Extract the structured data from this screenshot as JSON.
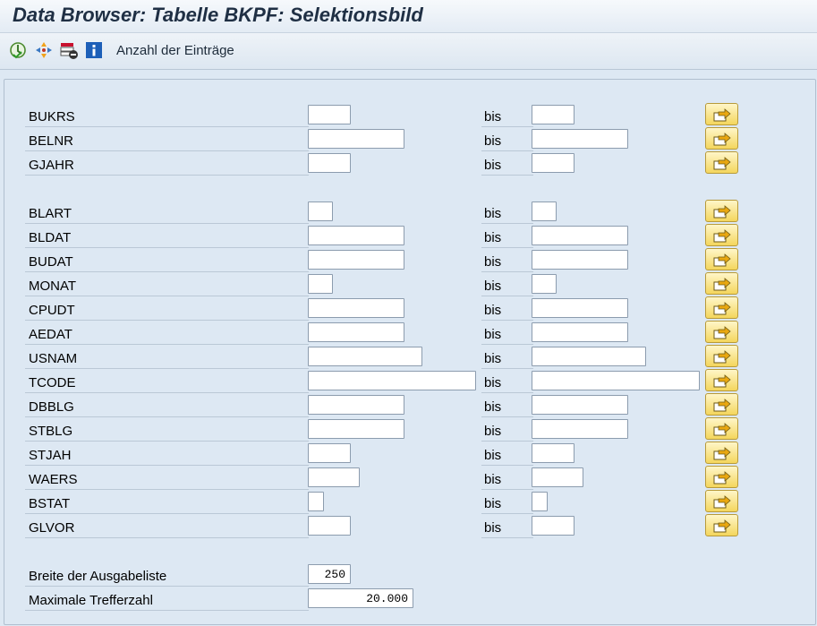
{
  "window": {
    "title": "Data Browser: Tabelle BKPF: Selektionsbild"
  },
  "toolbar": {
    "icons": [
      "execute-icon",
      "selection-options-icon",
      "delete-selection-icon",
      "info-icon"
    ],
    "count_entries_label": "Anzahl der Einträge"
  },
  "selection": {
    "bis_label": "bis",
    "fields": [
      {
        "name": "BUKRS",
        "low": "",
        "high": ""
      },
      {
        "name": "BELNR",
        "low": "",
        "high": ""
      },
      {
        "name": "GJAHR",
        "low": "",
        "high": ""
      },
      {
        "name": "BLART",
        "low": "",
        "high": ""
      },
      {
        "name": "BLDAT",
        "low": "",
        "high": ""
      },
      {
        "name": "BUDAT",
        "low": "",
        "high": ""
      },
      {
        "name": "MONAT",
        "low": "",
        "high": ""
      },
      {
        "name": "CPUDT",
        "low": "",
        "high": ""
      },
      {
        "name": "AEDAT",
        "low": "",
        "high": ""
      },
      {
        "name": "USNAM",
        "low": "",
        "high": ""
      },
      {
        "name": "TCODE",
        "low": "",
        "high": ""
      },
      {
        "name": "DBBLG",
        "low": "",
        "high": ""
      },
      {
        "name": "STBLG",
        "low": "",
        "high": ""
      },
      {
        "name": "STJAH",
        "low": "",
        "high": ""
      },
      {
        "name": "WAERS",
        "low": "",
        "high": ""
      },
      {
        "name": "BSTAT",
        "low": "",
        "high": ""
      },
      {
        "name": "GLVOR",
        "low": "",
        "high": ""
      }
    ]
  },
  "output": {
    "width_label": "Breite der Ausgabeliste",
    "width_value": "250",
    "max_hits_label": "Maximale Trefferzahl",
    "max_hits_value": "20.000"
  },
  "colors": {
    "background": "#dde8f3",
    "multi_select_button": "#f4d65d"
  }
}
